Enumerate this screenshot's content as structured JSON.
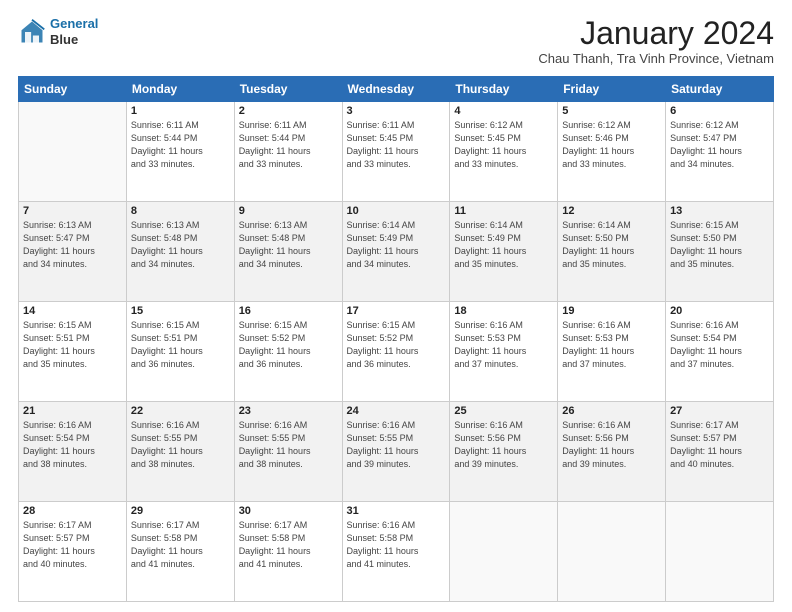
{
  "header": {
    "logo_line1": "General",
    "logo_line2": "Blue",
    "month_title": "January 2024",
    "subtitle": "Chau Thanh, Tra Vinh Province, Vietnam"
  },
  "days_of_week": [
    "Sunday",
    "Monday",
    "Tuesday",
    "Wednesday",
    "Thursday",
    "Friday",
    "Saturday"
  ],
  "weeks": [
    [
      {
        "num": "",
        "info": ""
      },
      {
        "num": "1",
        "info": "Sunrise: 6:11 AM\nSunset: 5:44 PM\nDaylight: 11 hours\nand 33 minutes."
      },
      {
        "num": "2",
        "info": "Sunrise: 6:11 AM\nSunset: 5:44 PM\nDaylight: 11 hours\nand 33 minutes."
      },
      {
        "num": "3",
        "info": "Sunrise: 6:11 AM\nSunset: 5:45 PM\nDaylight: 11 hours\nand 33 minutes."
      },
      {
        "num": "4",
        "info": "Sunrise: 6:12 AM\nSunset: 5:45 PM\nDaylight: 11 hours\nand 33 minutes."
      },
      {
        "num": "5",
        "info": "Sunrise: 6:12 AM\nSunset: 5:46 PM\nDaylight: 11 hours\nand 33 minutes."
      },
      {
        "num": "6",
        "info": "Sunrise: 6:12 AM\nSunset: 5:47 PM\nDaylight: 11 hours\nand 34 minutes."
      }
    ],
    [
      {
        "num": "7",
        "info": "Sunrise: 6:13 AM\nSunset: 5:47 PM\nDaylight: 11 hours\nand 34 minutes."
      },
      {
        "num": "8",
        "info": "Sunrise: 6:13 AM\nSunset: 5:48 PM\nDaylight: 11 hours\nand 34 minutes."
      },
      {
        "num": "9",
        "info": "Sunrise: 6:13 AM\nSunset: 5:48 PM\nDaylight: 11 hours\nand 34 minutes."
      },
      {
        "num": "10",
        "info": "Sunrise: 6:14 AM\nSunset: 5:49 PM\nDaylight: 11 hours\nand 34 minutes."
      },
      {
        "num": "11",
        "info": "Sunrise: 6:14 AM\nSunset: 5:49 PM\nDaylight: 11 hours\nand 35 minutes."
      },
      {
        "num": "12",
        "info": "Sunrise: 6:14 AM\nSunset: 5:50 PM\nDaylight: 11 hours\nand 35 minutes."
      },
      {
        "num": "13",
        "info": "Sunrise: 6:15 AM\nSunset: 5:50 PM\nDaylight: 11 hours\nand 35 minutes."
      }
    ],
    [
      {
        "num": "14",
        "info": "Sunrise: 6:15 AM\nSunset: 5:51 PM\nDaylight: 11 hours\nand 35 minutes."
      },
      {
        "num": "15",
        "info": "Sunrise: 6:15 AM\nSunset: 5:51 PM\nDaylight: 11 hours\nand 36 minutes."
      },
      {
        "num": "16",
        "info": "Sunrise: 6:15 AM\nSunset: 5:52 PM\nDaylight: 11 hours\nand 36 minutes."
      },
      {
        "num": "17",
        "info": "Sunrise: 6:15 AM\nSunset: 5:52 PM\nDaylight: 11 hours\nand 36 minutes."
      },
      {
        "num": "18",
        "info": "Sunrise: 6:16 AM\nSunset: 5:53 PM\nDaylight: 11 hours\nand 37 minutes."
      },
      {
        "num": "19",
        "info": "Sunrise: 6:16 AM\nSunset: 5:53 PM\nDaylight: 11 hours\nand 37 minutes."
      },
      {
        "num": "20",
        "info": "Sunrise: 6:16 AM\nSunset: 5:54 PM\nDaylight: 11 hours\nand 37 minutes."
      }
    ],
    [
      {
        "num": "21",
        "info": "Sunrise: 6:16 AM\nSunset: 5:54 PM\nDaylight: 11 hours\nand 38 minutes."
      },
      {
        "num": "22",
        "info": "Sunrise: 6:16 AM\nSunset: 5:55 PM\nDaylight: 11 hours\nand 38 minutes."
      },
      {
        "num": "23",
        "info": "Sunrise: 6:16 AM\nSunset: 5:55 PM\nDaylight: 11 hours\nand 38 minutes."
      },
      {
        "num": "24",
        "info": "Sunrise: 6:16 AM\nSunset: 5:55 PM\nDaylight: 11 hours\nand 39 minutes."
      },
      {
        "num": "25",
        "info": "Sunrise: 6:16 AM\nSunset: 5:56 PM\nDaylight: 11 hours\nand 39 minutes."
      },
      {
        "num": "26",
        "info": "Sunrise: 6:16 AM\nSunset: 5:56 PM\nDaylight: 11 hours\nand 39 minutes."
      },
      {
        "num": "27",
        "info": "Sunrise: 6:17 AM\nSunset: 5:57 PM\nDaylight: 11 hours\nand 40 minutes."
      }
    ],
    [
      {
        "num": "28",
        "info": "Sunrise: 6:17 AM\nSunset: 5:57 PM\nDaylight: 11 hours\nand 40 minutes."
      },
      {
        "num": "29",
        "info": "Sunrise: 6:17 AM\nSunset: 5:58 PM\nDaylight: 11 hours\nand 41 minutes."
      },
      {
        "num": "30",
        "info": "Sunrise: 6:17 AM\nSunset: 5:58 PM\nDaylight: 11 hours\nand 41 minutes."
      },
      {
        "num": "31",
        "info": "Sunrise: 6:16 AM\nSunset: 5:58 PM\nDaylight: 11 hours\nand 41 minutes."
      },
      {
        "num": "",
        "info": ""
      },
      {
        "num": "",
        "info": ""
      },
      {
        "num": "",
        "info": ""
      }
    ]
  ]
}
